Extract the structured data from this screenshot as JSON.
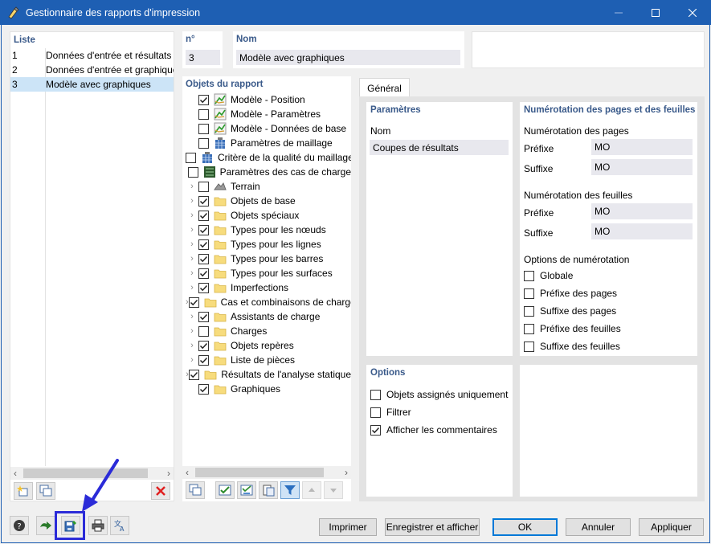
{
  "window": {
    "title": "Gestionnaire des rapports d'impression"
  },
  "list": {
    "header": "Liste",
    "items": [
      {
        "num": "1",
        "name": "Données d'entrée et résultats u"
      },
      {
        "num": "2",
        "name": "Données d'entrée et graphiques"
      },
      {
        "num": "3",
        "name": "Modèle avec graphiques"
      }
    ]
  },
  "record": {
    "no_header": "n°",
    "no_value": "3",
    "name_header": "Nom",
    "name_value": "Modèle avec graphiques"
  },
  "objects": {
    "header": "Objets du rapport",
    "items": [
      {
        "label": "Modèle - Position",
        "checked": true,
        "expand": false,
        "icon": "model-icon"
      },
      {
        "label": "Modèle - Paramètres",
        "checked": false,
        "expand": false,
        "icon": "model-icon"
      },
      {
        "label": "Modèle - Données de base",
        "checked": false,
        "expand": false,
        "icon": "model-icon"
      },
      {
        "label": "Paramètres de maillage",
        "checked": false,
        "expand": false,
        "icon": "mesh-icon"
      },
      {
        "label": "Critère de la qualité du maillage",
        "checked": false,
        "expand": false,
        "icon": "mesh-icon"
      },
      {
        "label": "Paramètres des cas de charge",
        "checked": false,
        "expand": false,
        "icon": "loadcase-icon"
      },
      {
        "label": "Terrain",
        "checked": false,
        "expand": true,
        "icon": "terrain-icon"
      },
      {
        "label": "Objets de base",
        "checked": true,
        "expand": true,
        "icon": "folder-icon"
      },
      {
        "label": "Objets spéciaux",
        "checked": true,
        "expand": true,
        "icon": "folder-icon"
      },
      {
        "label": "Types pour les nœuds",
        "checked": true,
        "expand": true,
        "icon": "folder-icon"
      },
      {
        "label": "Types pour les lignes",
        "checked": true,
        "expand": true,
        "icon": "folder-icon"
      },
      {
        "label": "Types pour les barres",
        "checked": true,
        "expand": true,
        "icon": "folder-icon"
      },
      {
        "label": "Types pour les surfaces",
        "checked": true,
        "expand": true,
        "icon": "folder-icon"
      },
      {
        "label": "Imperfections",
        "checked": true,
        "expand": true,
        "icon": "folder-icon"
      },
      {
        "label": "Cas et combinaisons de charges",
        "checked": true,
        "expand": true,
        "icon": "folder-icon"
      },
      {
        "label": "Assistants de charge",
        "checked": true,
        "expand": true,
        "icon": "folder-icon"
      },
      {
        "label": "Charges",
        "checked": false,
        "expand": true,
        "icon": "folder-icon"
      },
      {
        "label": "Objets repères",
        "checked": true,
        "expand": true,
        "icon": "folder-icon"
      },
      {
        "label": "Liste de pièces",
        "checked": true,
        "expand": true,
        "icon": "folder-icon"
      },
      {
        "label": "Résultats de l'analyse statique",
        "checked": true,
        "expand": true,
        "icon": "folder-icon"
      },
      {
        "label": "Graphiques",
        "checked": true,
        "expand": false,
        "icon": "folder-icon"
      }
    ]
  },
  "tabs": {
    "general": "Général"
  },
  "params": {
    "header": "Paramètres",
    "name_label": "Nom",
    "name_value": "Coupes de résultats"
  },
  "numbering": {
    "header": "Numérotation des pages et des feuilles",
    "pages_header": "Numérotation des pages",
    "prefix_label": "Préfixe",
    "suffix_label": "Suffixe",
    "pages_prefix": "MO",
    "pages_suffix": "MO",
    "sheets_header": "Numérotation des feuilles",
    "sheets_prefix": "MO",
    "sheets_suffix": "MO",
    "options_header": "Options de numérotation",
    "options": [
      {
        "label": "Globale",
        "checked": false
      },
      {
        "label": "Préfixe des pages",
        "checked": false
      },
      {
        "label": "Suffixe des pages",
        "checked": false
      },
      {
        "label": "Préfixe des feuilles",
        "checked": false
      },
      {
        "label": "Suffixe des feuilles",
        "checked": false
      }
    ]
  },
  "options": {
    "header": "Options",
    "items": [
      {
        "label": "Objets assignés uniquement",
        "checked": false
      },
      {
        "label": "Filtrer",
        "checked": false
      },
      {
        "label": "Afficher les commentaires",
        "checked": true
      }
    ]
  },
  "buttons": {
    "print": "Imprimer",
    "save_show": "Enregistrer et afficher",
    "ok": "OK",
    "cancel": "Annuler",
    "apply": "Appliquer"
  },
  "colors": {
    "titlebar": "#1e5fb3",
    "selection": "#cce4f7",
    "header_text": "#3a5a8a",
    "highlight": "#2b2bd8"
  }
}
